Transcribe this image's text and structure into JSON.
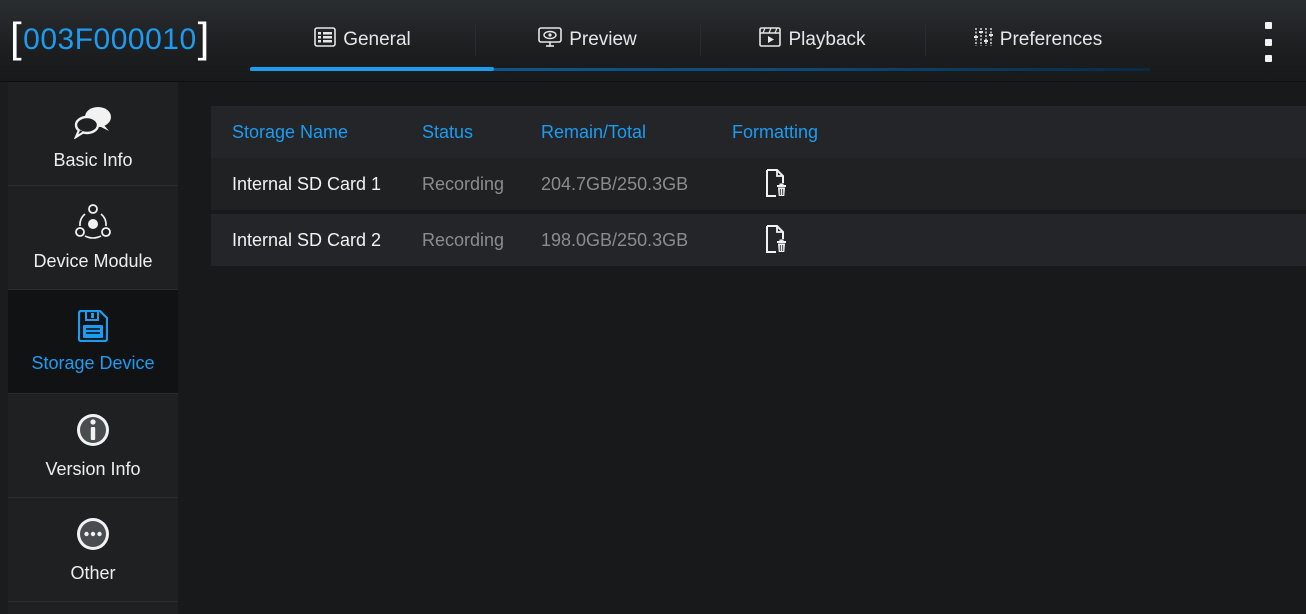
{
  "device": {
    "id": "003F000010",
    "open_bracket": "[",
    "close_bracket": "]"
  },
  "tabs": [
    {
      "label": "General",
      "icon": "grid-list-icon",
      "active": true
    },
    {
      "label": "Preview",
      "icon": "monitor-eye-icon",
      "active": false
    },
    {
      "label": "Playback",
      "icon": "film-play-icon",
      "active": false
    },
    {
      "label": "Preferences",
      "icon": "sliders-icon",
      "active": false
    }
  ],
  "menu": {
    "icon": "kebab-menu-icon"
  },
  "sidebar": {
    "items": [
      {
        "label": "Basic Info",
        "icon": "chat-bubbles-icon",
        "active": false
      },
      {
        "label": "Device Module",
        "icon": "module-nodes-icon",
        "active": false
      },
      {
        "label": "Storage Device",
        "icon": "floppy-disk-icon",
        "active": true
      },
      {
        "label": "Version Info",
        "icon": "info-circle-icon",
        "active": false
      },
      {
        "label": "Other",
        "icon": "more-circle-icon",
        "active": false
      }
    ]
  },
  "table": {
    "headers": {
      "name": "Storage Name",
      "status": "Status",
      "remain": "Remain/Total",
      "formatting": "Formatting"
    },
    "rows": [
      {
        "name": "Internal SD Card 1",
        "status": "Recording",
        "remain": "204.7GB/250.3GB",
        "format_icon": "format-file-trash-icon"
      },
      {
        "name": "Internal SD Card 2",
        "status": "Recording",
        "remain": "198.0GB/250.3GB",
        "format_icon": "format-file-trash-icon"
      }
    ]
  },
  "colors": {
    "accent": "#1c9cf0",
    "background": "#17191b",
    "text": "#f2f2f2",
    "muted": "#8a8c8e"
  }
}
